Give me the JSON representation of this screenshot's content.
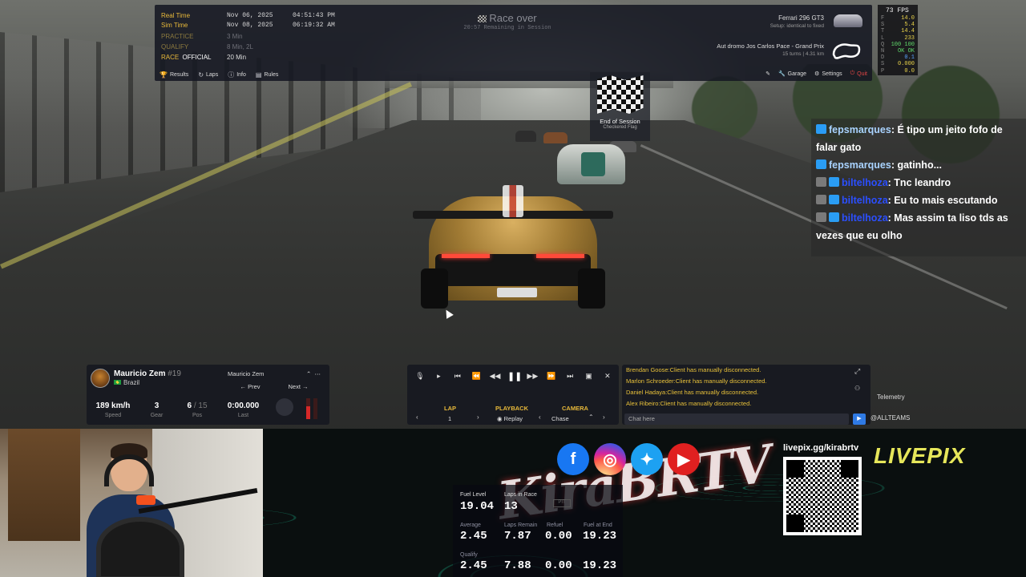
{
  "session": {
    "rows": [
      {
        "label": "Real Time",
        "date": "Nov 06, 2025",
        "time": "04:51:43 PM"
      },
      {
        "label": "Sim Time",
        "date": "Nov 08, 2025",
        "time": "06:19:32 AM"
      },
      {
        "label": "PRACTICE",
        "value": "3 Min"
      },
      {
        "label": "QUALIFY",
        "value": "8 Min, 2L"
      },
      {
        "label": "RACE",
        "tag": "OFFICIAL",
        "value": "20 Min"
      }
    ],
    "status_title": "Race over",
    "status_sub": "20:57 Remaining in Session"
  },
  "car": {
    "name": "Ferrari 296 GT3",
    "setup": "Setup: identical to fixed"
  },
  "track": {
    "name": "Aut dromo Jos  Carlos Pace - Grand Prix",
    "turns": "15 turns",
    "length": "4.31 km"
  },
  "tabs": [
    "Results",
    "Laps",
    "Info",
    "Rules"
  ],
  "right_tools": [
    "Garage",
    "Settings",
    "Quit"
  ],
  "fps": {
    "head": "73 FPS",
    "rows": [
      {
        "k": "F",
        "v": "14.0"
      },
      {
        "k": "S",
        "v": "5.4"
      },
      {
        "k": "T",
        "v": "14.4"
      },
      {
        "k": "L",
        "v": "233"
      },
      {
        "k": "Q",
        "v": "100 100"
      },
      {
        "k": "N",
        "v": "OK OK"
      },
      {
        "k": "D",
        "v": "0.1"
      },
      {
        "k": "S",
        "v": "0.000"
      },
      {
        "k": "P",
        "v": "0.0"
      }
    ]
  },
  "end_of_session": {
    "title": "End of Session",
    "sub": "Checkered Flag"
  },
  "chat": [
    {
      "user": "fepsmarques",
      "text": ": É tipo um jeito fofo de falar gato",
      "badge": "prime"
    },
    {
      "user": "fepsmarques",
      "text": ": gatinho...",
      "badge": "prime"
    },
    {
      "user": "biltelhoza",
      "text": ": Tnc leandro",
      "badge": "mod"
    },
    {
      "user": "biltelhoza",
      "text": ": Eu to mais escutando",
      "badge": "mod"
    },
    {
      "user": "biltelhoza",
      "text": ": Mas assim ta liso tds as vezes que eu olho",
      "badge": "mod"
    }
  ],
  "driver": {
    "name": "Mauricio Zem",
    "number": "#19",
    "country": "Brazil",
    "select": "Mauricio Zem",
    "prev": "Prev",
    "next": "Next",
    "speed": "189 km/h",
    "speed_label": "Speed",
    "gear": "3",
    "gear_label": "Gear",
    "pos": "6",
    "pos_total": "/ 15",
    "pos_label": "Pos",
    "last": "0:00.000",
    "last_label": "Last",
    "brake_level": 0.6
  },
  "replay": {
    "lap_label": "LAP",
    "lap_value": "1",
    "playback_label": "PLAYBACK",
    "playback_value": "Replay",
    "camera_label": "CAMERA",
    "camera_value": "Chase"
  },
  "log": [
    "Brendan Goose:Client has manually disconnected.",
    "Marlon Schroeder:Client has manually disconnected.",
    "Daniel Hadaya:Client has manually disconnected.",
    "Alex Ribeiro:Client has manually disconnected."
  ],
  "chat_input_placeholder": "Chat here",
  "telemetry": "Telemetry",
  "allteams": "@ALLTEAMS",
  "fuel": {
    "level_label": "Fuel Level",
    "level": "19.04",
    "laps_label": "Laps in Race",
    "laps": "13",
    "pit": "PIT",
    "average_label": "Average",
    "laps_remain_label": "Laps Remain",
    "refuel_label": "Refuel",
    "fuel_at_end_label": "Fuel at End",
    "average": [
      "2.45",
      "7.87",
      "0.00",
      "19.23"
    ],
    "qualify_label": "Qualify",
    "qualify": [
      "2.45",
      "7.88",
      "0.00",
      "19.23"
    ]
  },
  "brand": "KiraBRTV",
  "livepix_url": "livepix.gg/kirabrtv",
  "livepix_logo": "LIVEPIX"
}
